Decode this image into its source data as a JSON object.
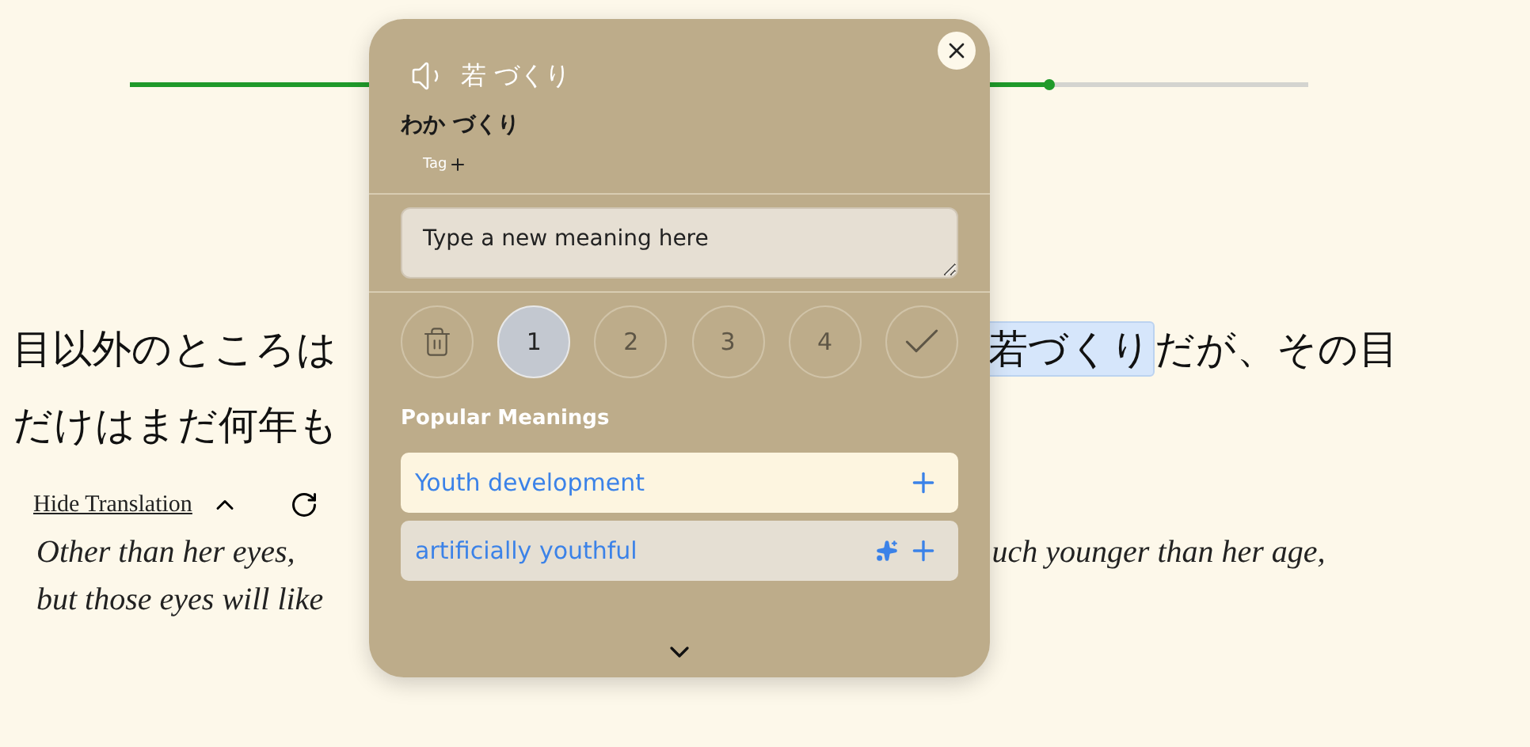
{
  "progress": {
    "level": 0.78
  },
  "sentence": {
    "lines": [
      {
        "before": "目以外のところは",
        "highlight": "若づくり",
        "after": "だが、その目"
      },
      {
        "before": "だけはまだ何年も"
      }
    ]
  },
  "translation_controls": {
    "toggle": "Hide Translation",
    "expanded": true
  },
  "translation": {
    "lines": [
      {
        "before": "Other than her eyes,",
        "after": "uch younger than her age,"
      },
      {
        "before": "but those eyes will like"
      }
    ]
  },
  "popup": {
    "word": "若 づくり",
    "reading": "わか づくり",
    "tag": "Tag",
    "meaning_placeholder": "Type a new meaning here",
    "ratings": [
      {
        "kind": "delete",
        "selected": false
      },
      {
        "kind": "number",
        "label": "1",
        "selected": true
      },
      {
        "kind": "number",
        "label": "2",
        "selected": false
      },
      {
        "kind": "number",
        "label": "3",
        "selected": false
      },
      {
        "kind": "number",
        "label": "4",
        "selected": false
      },
      {
        "kind": "done",
        "selected": false
      }
    ],
    "popular_title": "Popular Meanings",
    "meanings": [
      {
        "text": "Youth development",
        "hovered": true,
        "ai": false
      },
      {
        "text": "artificially youthful",
        "hovered": false,
        "ai": true
      }
    ]
  }
}
